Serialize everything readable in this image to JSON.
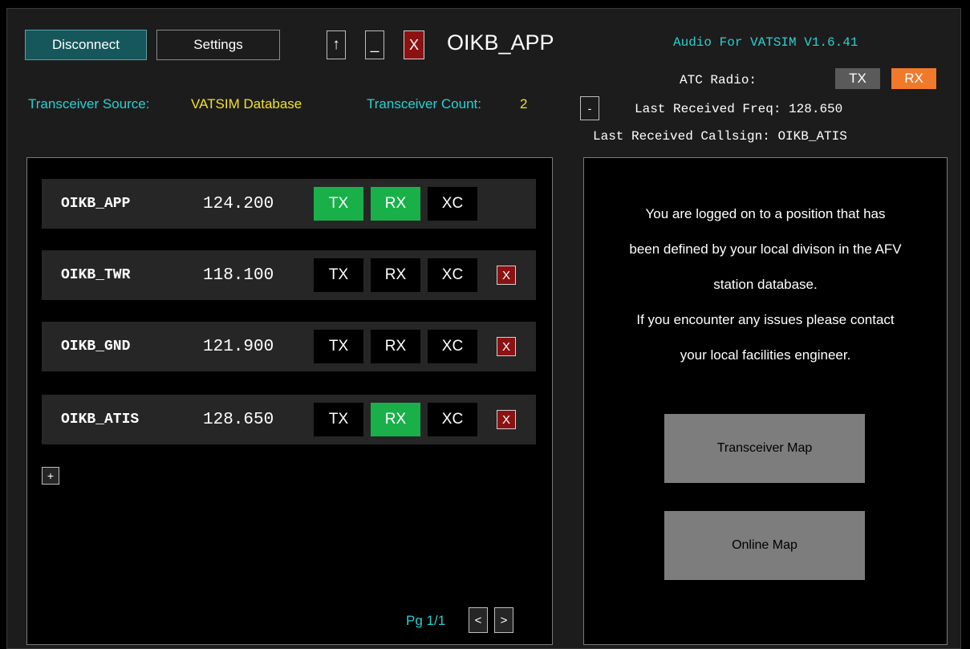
{
  "header": {
    "disconnect_label": "Disconnect",
    "settings_label": "Settings",
    "up_label": "↑",
    "minimize_label": "_",
    "close_label": "X",
    "callsign": "OIKB_APP"
  },
  "afv": {
    "version": "Audio For VATSIM V1.6.41",
    "atc_radio_label": "ATC Radio:",
    "atc_tx": "TX",
    "atc_rx": "RX",
    "collapse_label": "-",
    "last_freq": "Last Received Freq: 128.650",
    "last_callsign": "Last Received Callsign: OIKB_ATIS"
  },
  "source": {
    "label": "Transceiver Source:",
    "value": "VATSIM Database",
    "count_label": "Transceiver Count:",
    "count_value": "2"
  },
  "transceivers": [
    {
      "callsign": "OIKB_APP",
      "freq": "124.200",
      "tx": "TX",
      "rx": "RX",
      "xc": "XC",
      "remove": ""
    },
    {
      "callsign": "OIKB_TWR",
      "freq": "118.100",
      "tx": "TX",
      "rx": "RX",
      "xc": "XC",
      "remove": "X"
    },
    {
      "callsign": "OIKB_GND",
      "freq": "121.900",
      "tx": "TX",
      "rx": "RX",
      "xc": "XC",
      "remove": "X"
    },
    {
      "callsign": "OIKB_ATIS",
      "freq": "128.650",
      "tx": "TX",
      "rx": "RX",
      "xc": "XC",
      "remove": "X"
    }
  ],
  "add_label": "+",
  "paging": {
    "label": "Pg 1/1",
    "prev_label": "<",
    "next_label": ">"
  },
  "info": {
    "line1": "You are logged on to a position that has",
    "line2": "been defined by your local divison in the AFV",
    "line3": "station database.",
    "line4": "If you encounter any issues please contact",
    "line5": "your local facilities engineer.",
    "transceiver_map_label": "Transceiver Map",
    "online_map_label": "Online Map"
  },
  "colors": {
    "accent_cyan": "#2ad0d0",
    "value_yellow": "#f2e02a",
    "active_green": "#19b04a",
    "rx_orange": "#f07a2a",
    "danger_red": "#8c1212"
  }
}
